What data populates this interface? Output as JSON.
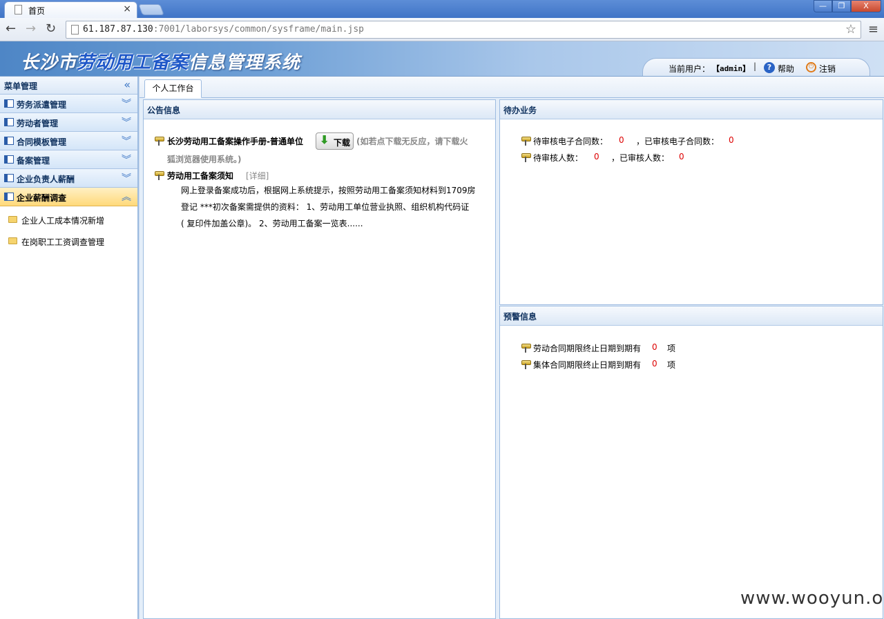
{
  "browser": {
    "tab_title": "首页",
    "tab_close": "×",
    "url_host": "61.187.87.130",
    "url_rest": ":7001/laborsys/common/sysframe/main.jsp",
    "win_min": "—",
    "win_max": "❐",
    "win_close": "X"
  },
  "header": {
    "title_pre": "长沙市",
    "title_highlight": "劳动用工备案",
    "title_post": "信息管理系统",
    "current_user_label": "当前用户：",
    "current_user": "【admin】",
    "separator": "|",
    "help_label": "帮助",
    "logout_label": "注销"
  },
  "sidebar": {
    "title": "菜单管理",
    "items": [
      {
        "label": "劳务派遣管理"
      },
      {
        "label": "劳动者管理"
      },
      {
        "label": "合同模板管理"
      },
      {
        "label": "备案管理"
      },
      {
        "label": "企业负责人薪酬"
      },
      {
        "label": "企业薪酬调查"
      }
    ],
    "sub_items": [
      {
        "label": "企业人工成本情况新增"
      },
      {
        "label": "在岗职工工资调查管理"
      }
    ]
  },
  "main": {
    "tab_label": "个人工作台",
    "announce": {
      "title": "公告信息",
      "manual_title": "长沙劳动用工备案操作手册-普通单位",
      "download_label": "下载",
      "note_line1": "(如若点下载无反应，请下载火",
      "note_line2": "狐浏览器使用系统。)",
      "notice_title": "劳动用工备案须知",
      "detail_link": "[详细]",
      "body_line1": "网上登录备案成功后，根据网上系统提示，按照劳动用工备案须知材料到1709房",
      "body_line2": "登记 ***初次备案需提供的资料： 1、劳动用工单位营业执照、组织机构代码证",
      "body_line3": "( 复印件加盖公章)。 2、劳动用工备案一览表......"
    },
    "pending": {
      "title": "待办业务",
      "unreviewed_contracts_label": "待审核电子合同数：",
      "unreviewed_contracts": "0",
      "reviewed_contracts_label": "，已审核电子合同数：",
      "reviewed_contracts": "0",
      "unreviewed_people_label": "待审核人数：",
      "unreviewed_people": "0",
      "reviewed_people_label": "，已审核人数：",
      "reviewed_people": "0"
    },
    "warning": {
      "title": "预警信息",
      "labor_label": "劳动合同期限终止日期到期有",
      "labor_count": "0",
      "collective_label": "集体合同期限终止日期到期有",
      "collective_count": "0",
      "unit": "项"
    }
  },
  "watermark": "www.wooyun.org"
}
